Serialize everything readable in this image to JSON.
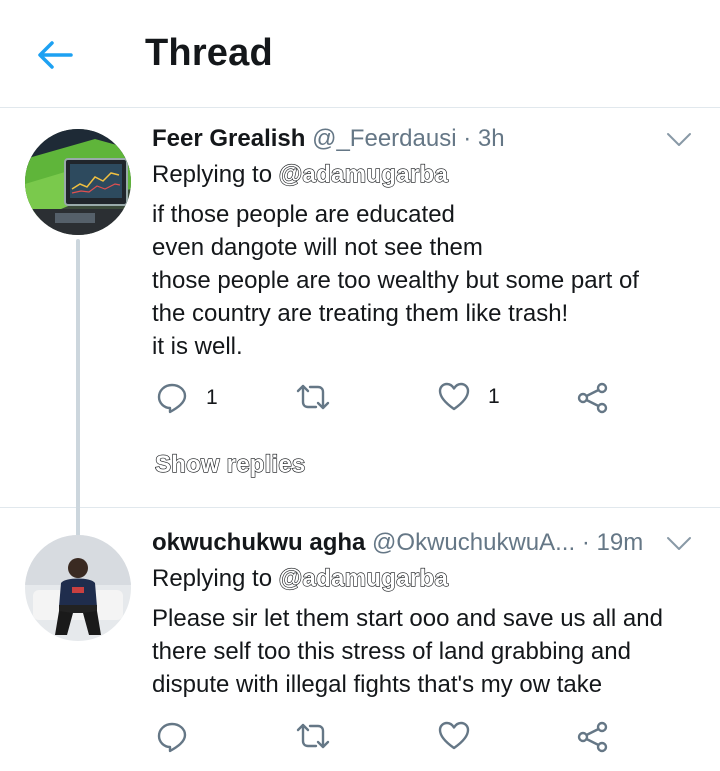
{
  "header": {
    "title": "Thread"
  },
  "colors": {
    "accent": "#1da1f2",
    "secondary_text": "#657786",
    "divider": "#e1e8ed"
  },
  "tweets": [
    {
      "name": "Feer Grealish",
      "handle": "@_Feerdausi",
      "dot": "·",
      "time": "3h",
      "replying_to_label": "Replying to",
      "replying_to": "@adamugarba",
      "lines": [
        "if those people are educated",
        "even dangote will not see them",
        "those people are too wealthy but some part of",
        "the country are treating them like trash!",
        "it is well."
      ],
      "reply_count": "1",
      "retweet_count": "",
      "like_count": "1",
      "show_replies": "Show replies",
      "icons": [
        "reply-icon",
        "retweet-icon",
        "like-icon",
        "share-icon",
        "chevron-down-icon"
      ]
    },
    {
      "name": "okwuchukwu agha",
      "handle": "@OkwuchukwuA...",
      "dot": "·",
      "time": "19m",
      "replying_to_label": "Replying to",
      "replying_to": "@adamugarba",
      "lines": [
        "Please sir let them start ooo and save us all and",
        "there self too this stress of land grabbing and",
        "dispute with illegal fights that's my ow take"
      ],
      "reply_count": "",
      "retweet_count": "",
      "like_count": "",
      "icons": [
        "reply-icon",
        "retweet-icon",
        "like-icon",
        "share-icon",
        "chevron-down-icon"
      ]
    }
  ]
}
